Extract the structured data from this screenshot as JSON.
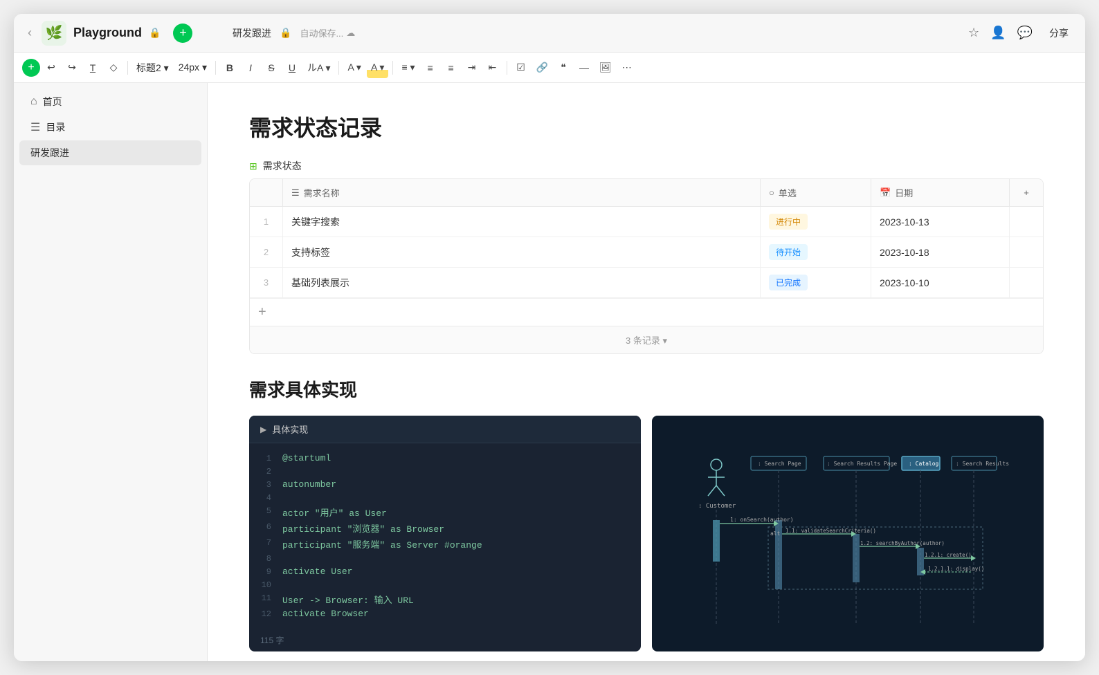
{
  "window": {
    "title": "Playground"
  },
  "titlebar": {
    "back_label": "‹",
    "app_icon": "🌿",
    "app_name": "Playground",
    "lock_icon": "🔒",
    "doc_title": "研发跟进",
    "autosave": "自动保存...",
    "cloud_icon": "☁",
    "star_icon": "☆",
    "user_icon": "👤",
    "comment_icon": "💬",
    "share_label": "分享"
  },
  "toolbar": {
    "add_label": "+",
    "undo_label": "↩",
    "redo_label": "↪",
    "format_label": "T",
    "clear_label": "◇",
    "heading_label": "标题2",
    "heading_arrow": "▾",
    "font_size_label": "24px",
    "font_size_arrow": "▾",
    "bold_label": "B",
    "italic_label": "I",
    "strikethrough_label": "S",
    "underline_label": "U",
    "ruby_label": "ルA",
    "font_color_label": "A",
    "highlight_label": "A",
    "align_label": "≡",
    "align_arrow": "▾",
    "list_label": "≡",
    "ordered_list_label": "≡",
    "indent_label": "≡",
    "outdent_label": "≡",
    "check_label": "☑",
    "link_label": "🔗",
    "quote_label": "❝",
    "hr_label": "—",
    "image_label": "🖼",
    "more_label": "⋯"
  },
  "sidebar": {
    "items": [
      {
        "id": "home",
        "icon": "⌂",
        "label": "首页"
      },
      {
        "id": "catalog",
        "icon": "☰",
        "label": "目录"
      },
      {
        "id": "devtrack",
        "icon": "",
        "label": "研发跟进",
        "active": true
      }
    ]
  },
  "content": {
    "page_title": "需求状态记录",
    "database": {
      "header_label": "需求状态",
      "columns": [
        {
          "icon": "☰",
          "label": "需求名称"
        },
        {
          "icon": "○",
          "label": "单选"
        },
        {
          "icon": "📅",
          "label": "日期"
        },
        {
          "icon": "+",
          "label": ""
        }
      ],
      "rows": [
        {
          "num": "1",
          "name": "关键字搜索",
          "status": "进行中",
          "status_type": "inprogress",
          "date": "2023-10-13"
        },
        {
          "num": "2",
          "name": "支持标签",
          "status": "待开始",
          "status_type": "pending",
          "date": "2023-10-18"
        },
        {
          "num": "3",
          "name": "基础列表展示",
          "status": "已完成",
          "status_type": "done",
          "date": "2023-10-10"
        }
      ],
      "footer": "3 条记录 ▾"
    },
    "section2_title": "需求具体实现",
    "code_block": {
      "title": "具体实现",
      "lines": [
        {
          "num": "1",
          "code": "@startuml"
        },
        {
          "num": "2",
          "code": ""
        },
        {
          "num": "3",
          "code": "autonumber"
        },
        {
          "num": "4",
          "code": ""
        },
        {
          "num": "5",
          "code": "actor \"用户\" as User"
        },
        {
          "num": "6",
          "code": "participant \"浏览器\" as Browser"
        },
        {
          "num": "7",
          "code": "participant \"服务端\" as Server #orange"
        },
        {
          "num": "8",
          "code": ""
        },
        {
          "num": "9",
          "code": "activate User"
        },
        {
          "num": "10",
          "code": ""
        },
        {
          "num": "11",
          "code": "User -> Browser: 输入 URL"
        },
        {
          "num": "12",
          "code": "activate Browser"
        }
      ],
      "footer": "115 字"
    },
    "diagram_block": {
      "labels": [
        ": Search Page",
        ": Search Results Page",
        ": Catalog",
        ": Search Results"
      ],
      "customer_label": ": Customer",
      "calls": [
        "1: onSearch(author)",
        "1.1: validateSearchCriteria()",
        "1.2: searchByAuthor(author)",
        "1.2.1: create()",
        "1.2.1.1: display()"
      ],
      "alt_label": "alt"
    }
  }
}
